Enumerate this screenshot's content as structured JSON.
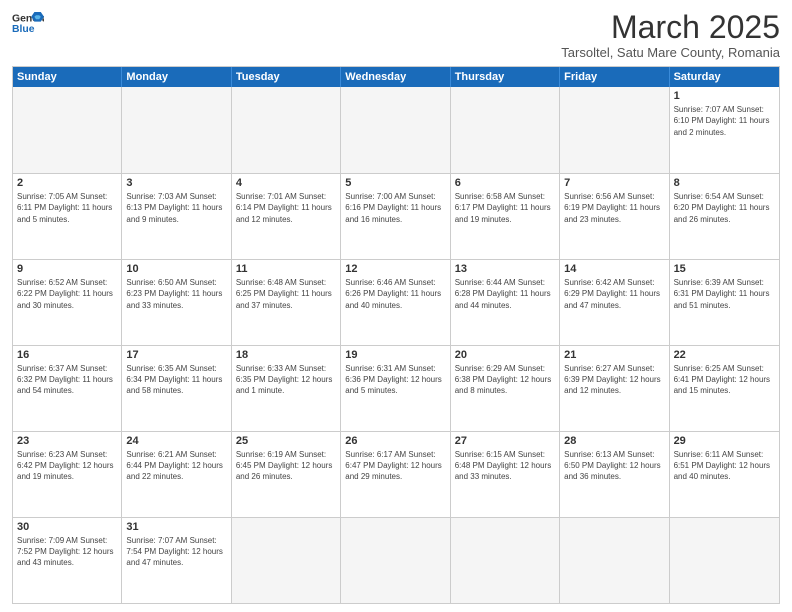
{
  "header": {
    "logo_general": "General",
    "logo_blue": "Blue",
    "month": "March 2025",
    "location": "Tarsoltel, Satu Mare County, Romania"
  },
  "days_of_week": [
    "Sunday",
    "Monday",
    "Tuesday",
    "Wednesday",
    "Thursday",
    "Friday",
    "Saturday"
  ],
  "weeks": [
    [
      {
        "day": "",
        "info": ""
      },
      {
        "day": "",
        "info": ""
      },
      {
        "day": "",
        "info": ""
      },
      {
        "day": "",
        "info": ""
      },
      {
        "day": "",
        "info": ""
      },
      {
        "day": "",
        "info": ""
      },
      {
        "day": "1",
        "info": "Sunrise: 7:07 AM\nSunset: 6:10 PM\nDaylight: 11 hours\nand 2 minutes."
      }
    ],
    [
      {
        "day": "2",
        "info": "Sunrise: 7:05 AM\nSunset: 6:11 PM\nDaylight: 11 hours\nand 5 minutes."
      },
      {
        "day": "3",
        "info": "Sunrise: 7:03 AM\nSunset: 6:13 PM\nDaylight: 11 hours\nand 9 minutes."
      },
      {
        "day": "4",
        "info": "Sunrise: 7:01 AM\nSunset: 6:14 PM\nDaylight: 11 hours\nand 12 minutes."
      },
      {
        "day": "5",
        "info": "Sunrise: 7:00 AM\nSunset: 6:16 PM\nDaylight: 11 hours\nand 16 minutes."
      },
      {
        "day": "6",
        "info": "Sunrise: 6:58 AM\nSunset: 6:17 PM\nDaylight: 11 hours\nand 19 minutes."
      },
      {
        "day": "7",
        "info": "Sunrise: 6:56 AM\nSunset: 6:19 PM\nDaylight: 11 hours\nand 23 minutes."
      },
      {
        "day": "8",
        "info": "Sunrise: 6:54 AM\nSunset: 6:20 PM\nDaylight: 11 hours\nand 26 minutes."
      }
    ],
    [
      {
        "day": "9",
        "info": "Sunrise: 6:52 AM\nSunset: 6:22 PM\nDaylight: 11 hours\nand 30 minutes."
      },
      {
        "day": "10",
        "info": "Sunrise: 6:50 AM\nSunset: 6:23 PM\nDaylight: 11 hours\nand 33 minutes."
      },
      {
        "day": "11",
        "info": "Sunrise: 6:48 AM\nSunset: 6:25 PM\nDaylight: 11 hours\nand 37 minutes."
      },
      {
        "day": "12",
        "info": "Sunrise: 6:46 AM\nSunset: 6:26 PM\nDaylight: 11 hours\nand 40 minutes."
      },
      {
        "day": "13",
        "info": "Sunrise: 6:44 AM\nSunset: 6:28 PM\nDaylight: 11 hours\nand 44 minutes."
      },
      {
        "day": "14",
        "info": "Sunrise: 6:42 AM\nSunset: 6:29 PM\nDaylight: 11 hours\nand 47 minutes."
      },
      {
        "day": "15",
        "info": "Sunrise: 6:39 AM\nSunset: 6:31 PM\nDaylight: 11 hours\nand 51 minutes."
      }
    ],
    [
      {
        "day": "16",
        "info": "Sunrise: 6:37 AM\nSunset: 6:32 PM\nDaylight: 11 hours\nand 54 minutes."
      },
      {
        "day": "17",
        "info": "Sunrise: 6:35 AM\nSunset: 6:34 PM\nDaylight: 11 hours\nand 58 minutes."
      },
      {
        "day": "18",
        "info": "Sunrise: 6:33 AM\nSunset: 6:35 PM\nDaylight: 12 hours\nand 1 minute."
      },
      {
        "day": "19",
        "info": "Sunrise: 6:31 AM\nSunset: 6:36 PM\nDaylight: 12 hours\nand 5 minutes."
      },
      {
        "day": "20",
        "info": "Sunrise: 6:29 AM\nSunset: 6:38 PM\nDaylight: 12 hours\nand 8 minutes."
      },
      {
        "day": "21",
        "info": "Sunrise: 6:27 AM\nSunset: 6:39 PM\nDaylight: 12 hours\nand 12 minutes."
      },
      {
        "day": "22",
        "info": "Sunrise: 6:25 AM\nSunset: 6:41 PM\nDaylight: 12 hours\nand 15 minutes."
      }
    ],
    [
      {
        "day": "23",
        "info": "Sunrise: 6:23 AM\nSunset: 6:42 PM\nDaylight: 12 hours\nand 19 minutes."
      },
      {
        "day": "24",
        "info": "Sunrise: 6:21 AM\nSunset: 6:44 PM\nDaylight: 12 hours\nand 22 minutes."
      },
      {
        "day": "25",
        "info": "Sunrise: 6:19 AM\nSunset: 6:45 PM\nDaylight: 12 hours\nand 26 minutes."
      },
      {
        "day": "26",
        "info": "Sunrise: 6:17 AM\nSunset: 6:47 PM\nDaylight: 12 hours\nand 29 minutes."
      },
      {
        "day": "27",
        "info": "Sunrise: 6:15 AM\nSunset: 6:48 PM\nDaylight: 12 hours\nand 33 minutes."
      },
      {
        "day": "28",
        "info": "Sunrise: 6:13 AM\nSunset: 6:50 PM\nDaylight: 12 hours\nand 36 minutes."
      },
      {
        "day": "29",
        "info": "Sunrise: 6:11 AM\nSunset: 6:51 PM\nDaylight: 12 hours\nand 40 minutes."
      }
    ],
    [
      {
        "day": "30",
        "info": "Sunrise: 7:09 AM\nSunset: 7:52 PM\nDaylight: 12 hours\nand 43 minutes."
      },
      {
        "day": "31",
        "info": "Sunrise: 7:07 AM\nSunset: 7:54 PM\nDaylight: 12 hours\nand 47 minutes."
      },
      {
        "day": "",
        "info": ""
      },
      {
        "day": "",
        "info": ""
      },
      {
        "day": "",
        "info": ""
      },
      {
        "day": "",
        "info": ""
      },
      {
        "day": "",
        "info": ""
      }
    ]
  ]
}
